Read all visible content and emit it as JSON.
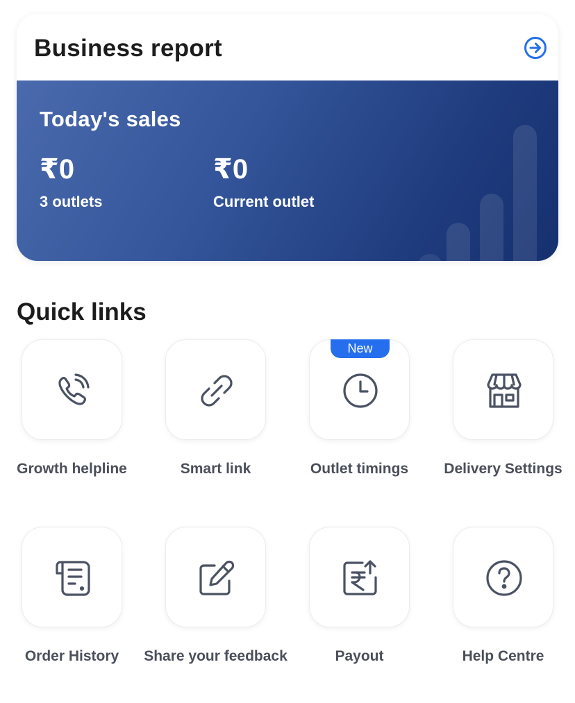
{
  "report": {
    "title": "Business report",
    "arrow_icon": "arrow-right-circle-icon"
  },
  "sales": {
    "heading": "Today's sales",
    "all_outlets": {
      "value": "₹0",
      "label": "3 outlets"
    },
    "current_outlet": {
      "value": "₹0",
      "label": "Current outlet"
    }
  },
  "quick_links": {
    "title": "Quick links",
    "items": [
      {
        "label": "Growth helpline",
        "icon": "phone-call-icon"
      },
      {
        "label": "Smart link",
        "icon": "link-icon"
      },
      {
        "label": "Outlet timings",
        "icon": "clock-icon",
        "badge": "New"
      },
      {
        "label": "Delivery Settings",
        "icon": "store-icon"
      },
      {
        "label": "Order History",
        "icon": "receipt-icon"
      },
      {
        "label": "Share your feedback",
        "icon": "edit-icon"
      },
      {
        "label": "Payout",
        "icon": "rupee-payout-icon"
      },
      {
        "label": "Help Centre",
        "icon": "help-circle-icon"
      }
    ]
  },
  "colors": {
    "accent": "#256fef",
    "panel_gradient_start": "#4a6aad",
    "panel_gradient_end": "#16306f",
    "icon_stroke": "#4a5263"
  }
}
